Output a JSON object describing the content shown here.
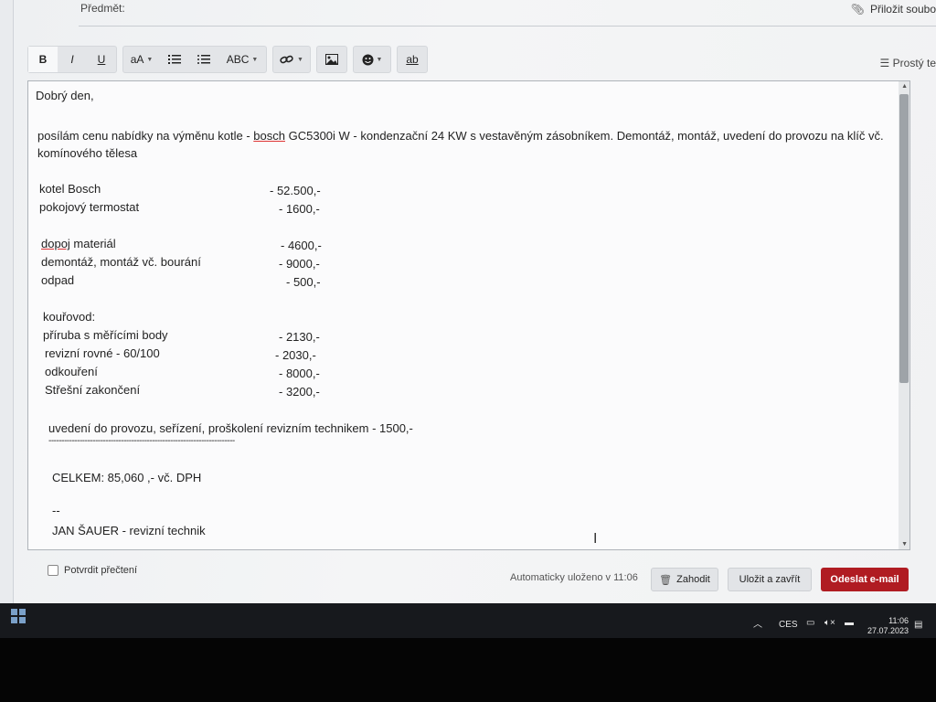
{
  "email": {
    "subject_label": "Předmět:",
    "attach_label": "Přiložit soubo",
    "plain_text_label": "Prostý te",
    "toolbar": {
      "bold": "B",
      "italic": "I",
      "underline": "U",
      "font_size": "aA",
      "spell": "ABC",
      "format_clear": "ab"
    },
    "body": {
      "greeting": "Dobrý den,",
      "intro_pre": "posílám cenu nabídky na výměnu kotle - ",
      "intro_brand": "bosch",
      "intro_post": " GC5300i W - kondenzační 24 KW s vestavěným zásobníkem. Demontáž, montáž, uvedení do provozu na klíč vč. komínového tělesa",
      "items": [
        {
          "label": "kotel Bosch",
          "price": "- 52.500,-"
        },
        {
          "label": "pokojový termostat",
          "price": "- 1600,-"
        },
        {
          "label": "dopoj",
          "label_rest": " materiál",
          "price": "- 4600,-"
        },
        {
          "label": "demontáž, montáž vč. bourání",
          "price": "- 9000,-"
        },
        {
          "label": "odpad",
          "price": "- 500,-"
        },
        {
          "label": "kouřovod:",
          "price": ""
        },
        {
          "label": "příruba s měřícími body",
          "price": "- 2130,-"
        },
        {
          "label": "revizní rovné - 60/100",
          "price": "- 2030,-"
        },
        {
          "label": "odkouření",
          "price": "- 8000,-"
        },
        {
          "label": "Střešní zakončení",
          "price": "- 3200,-"
        }
      ],
      "commissioning": "uvedení do provozu, seřízení, proškolení revizním technikem - 1500,-",
      "separator": "------------------------------------------------------------------------",
      "total": "CELKEM:  85,060 ,-  vč. DPH",
      "sig_dash": "--",
      "signature": "JAN ŠAUER - revizní technik"
    },
    "footer": {
      "confirm_read": "Potvrdit přečtení",
      "autosaved": "Automaticky uloženo v 11:06",
      "discard": "Zahodit",
      "save_close": "Uložit a zavřít",
      "send": "Odeslat e-mail"
    }
  },
  "taskbar": {
    "lang": "CES",
    "time": "11:06",
    "date": "27.07.2023"
  },
  "colors": {
    "send_button": "#b01c22",
    "taskbar": "#17191d"
  }
}
